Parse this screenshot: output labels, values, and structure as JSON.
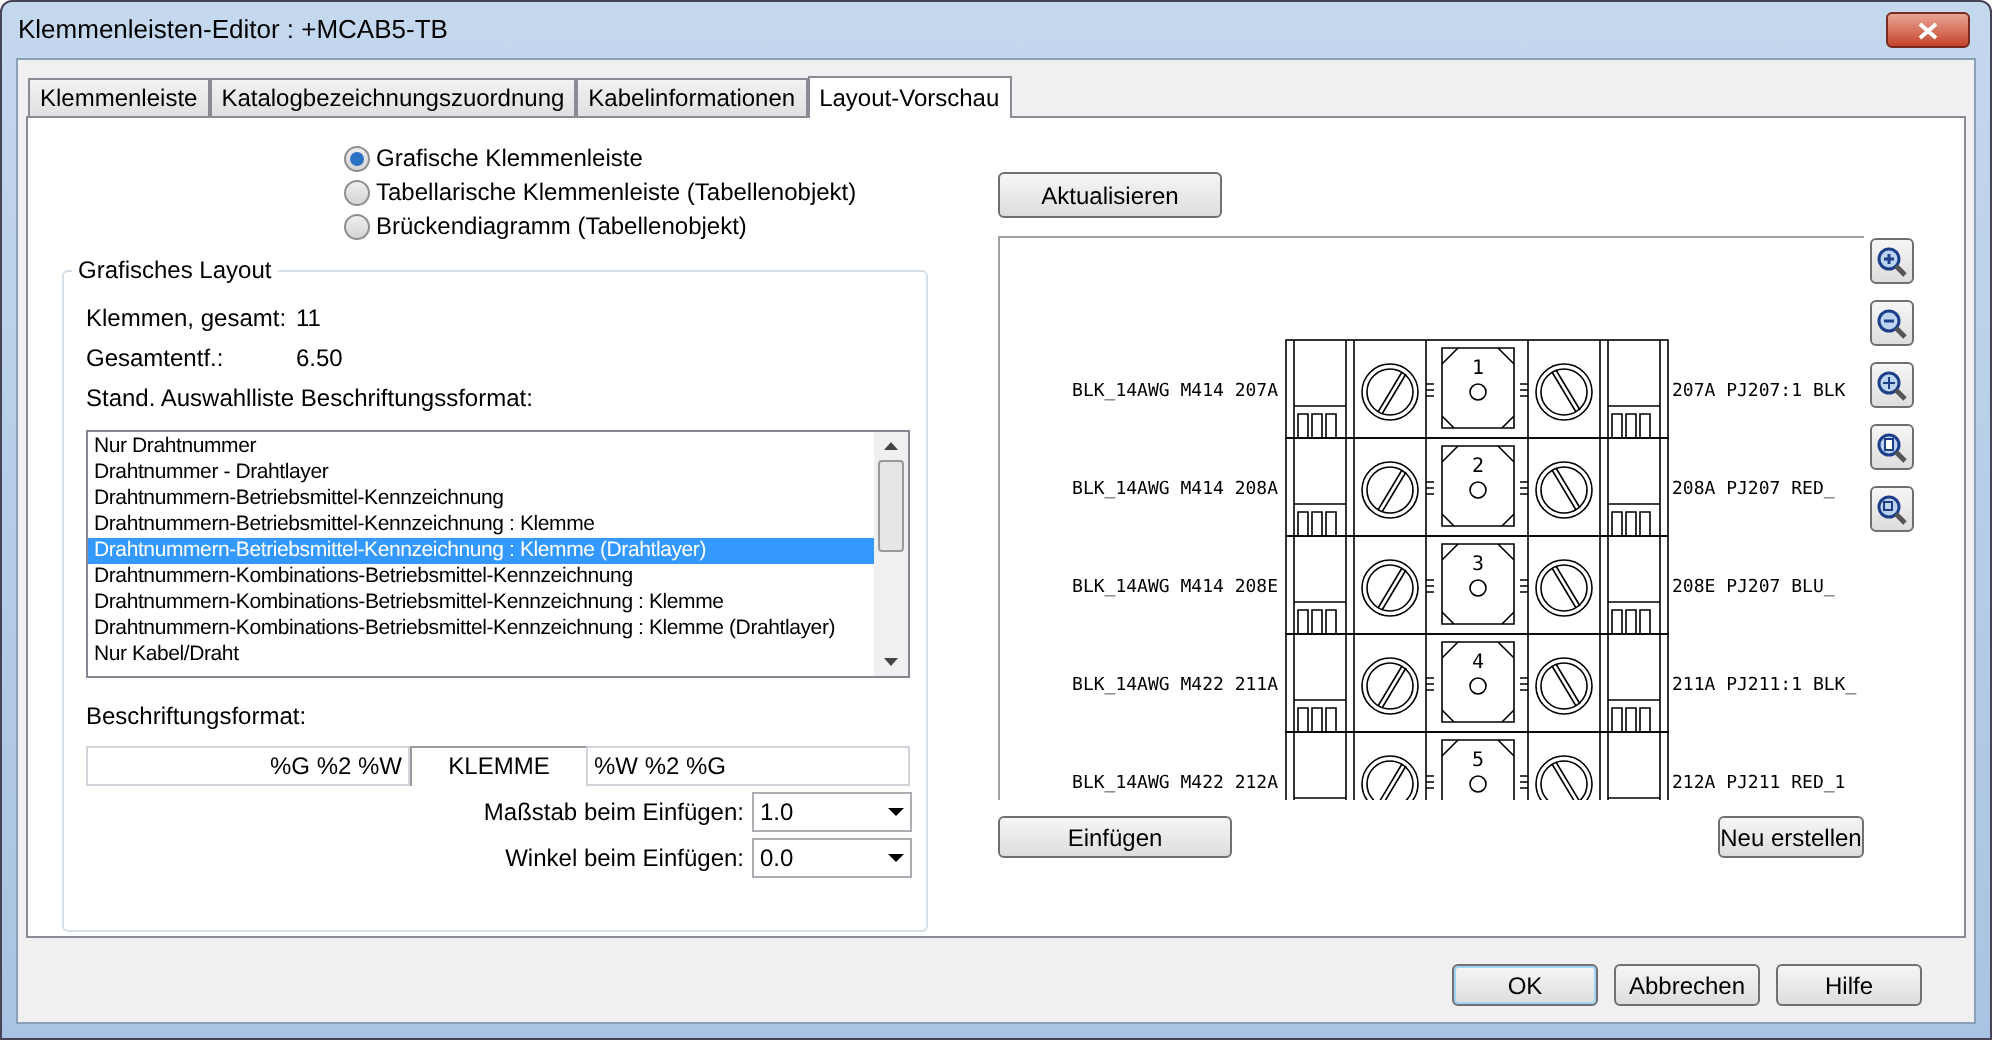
{
  "window": {
    "title": "Klemmenleisten-Editor : +MCAB5-TB"
  },
  "tabs": [
    {
      "label": "Klemmenleiste",
      "selected": false
    },
    {
      "label": "Katalogbezeichnungszuordnung",
      "selected": false
    },
    {
      "label": "Kabelinformationen",
      "selected": false
    },
    {
      "label": "Layout-Vorschau",
      "selected": true
    }
  ],
  "layout_options": [
    {
      "label": "Grafische Klemmenleiste",
      "selected": true
    },
    {
      "label": "Tabellarische Klemmenleiste (Tabellenobjekt)",
      "selected": false
    },
    {
      "label": "Brückendiagramm (Tabellenobjekt)",
      "selected": false
    }
  ],
  "group": {
    "title": "Grafisches Layout",
    "fields": [
      {
        "label": "Klemmen, gesamt:",
        "value": "11"
      },
      {
        "label": "Gesamtentf.:",
        "value": "6.50"
      }
    ],
    "list_label": "Stand. Auswahlliste Beschriftungssformat:",
    "list_items": [
      {
        "label": "Nur Drahtnummer",
        "selected": false
      },
      {
        "label": "Drahtnummer - Drahtlayer",
        "selected": false
      },
      {
        "label": "Drahtnummern-Betriebsmittel-Kennzeichnung",
        "selected": false
      },
      {
        "label": "Drahtnummern-Betriebsmittel-Kennzeichnung : Klemme",
        "selected": false
      },
      {
        "label": "Drahtnummern-Betriebsmittel-Kennzeichnung : Klemme (Drahtlayer)",
        "selected": true
      },
      {
        "label": "Drahtnummern-Kombinations-Betriebsmittel-Kennzeichnung",
        "selected": false
      },
      {
        "label": "Drahtnummern-Kombinations-Betriebsmittel-Kennzeichnung : Klemme",
        "selected": false
      },
      {
        "label": "Drahtnummern-Kombinations-Betriebsmittel-Kennzeichnung : Klemme (Drahtlayer)",
        "selected": false
      },
      {
        "label": "Nur Kabel/Draht",
        "selected": false
      }
    ],
    "format_label": "Beschriftungsformat:",
    "format_fields": [
      "%G %2 %W",
      "KLEMME",
      "%W %2 %G"
    ],
    "scale": {
      "label": "Maßstab beim Einfügen:",
      "value": "1.0"
    },
    "angle": {
      "label": "Winkel beim Einfügen:",
      "value": "0.0"
    }
  },
  "preview": {
    "update_button": "Aktualisieren",
    "terminals": [
      {
        "number": "1",
        "left": "BLK_14AWG M414 207A",
        "right": "207A PJ207:1 BLK"
      },
      {
        "number": "2",
        "left": "BLK_14AWG M414 208A",
        "right": "208A PJ207 RED_"
      },
      {
        "number": "3",
        "left": "BLK_14AWG M414 208E",
        "right": "208E PJ207 BLU_"
      },
      {
        "number": "4",
        "left": "BLK_14AWG M422 211A",
        "right": "211A PJ211:1 BLK_"
      },
      {
        "number": "5",
        "left": "BLK_14AWG M422 212A",
        "right": "212A PJ211 RED_1"
      }
    ],
    "insert_button": "Einfügen",
    "new_button": "Neu erstellen"
  },
  "buttons": [
    "OK",
    "Abbrechen",
    "Hilfe"
  ]
}
